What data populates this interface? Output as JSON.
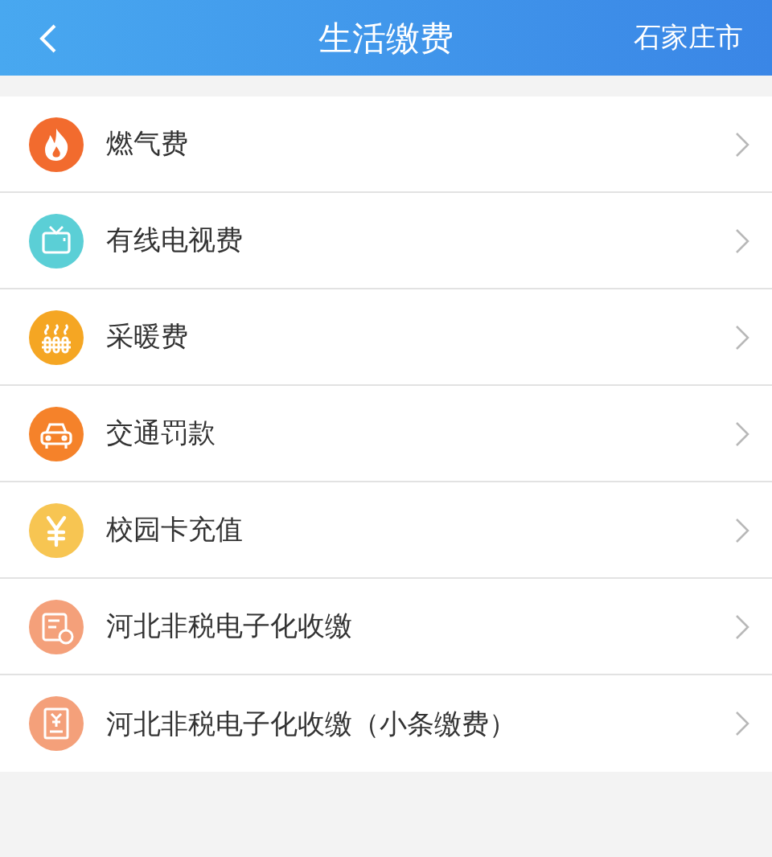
{
  "header": {
    "title": "生活缴费",
    "city": "石家庄市"
  },
  "items": [
    {
      "label": "燃气费",
      "kind": "flame",
      "color": "#f26b2e"
    },
    {
      "label": "有线电视费",
      "kind": "tv",
      "color": "#5bcfd6"
    },
    {
      "label": "采暖费",
      "kind": "heater",
      "color": "#f5a623"
    },
    {
      "label": "交通罚款",
      "kind": "car",
      "color": "#f5822a"
    },
    {
      "label": "校园卡充值",
      "kind": "yen",
      "color": "#f7c552"
    },
    {
      "label": "河北非税电子化收缴",
      "kind": "receipt",
      "color": "#f4a07a"
    },
    {
      "label": "河北非税电子化收缴（小条缴费）",
      "kind": "document",
      "color": "#f4a07a"
    }
  ]
}
